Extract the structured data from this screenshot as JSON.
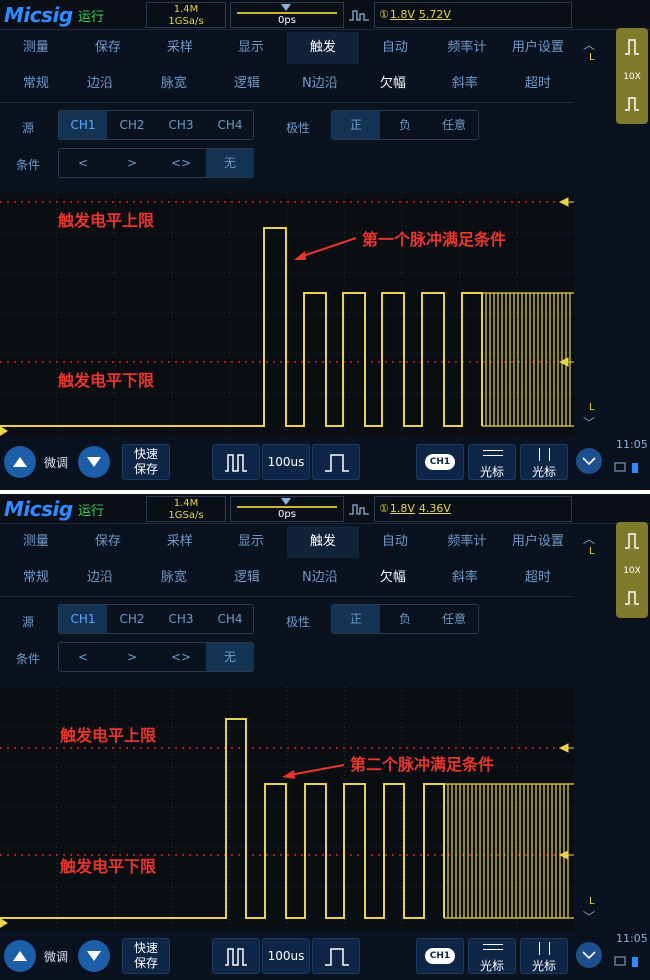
{
  "panels": [
    {
      "header": {
        "logo": "Micsig",
        "run_state": "运行",
        "memory_depth": "1.4M",
        "sample_rate": "1GSa/s",
        "time_offset": "0ps",
        "trigger_channel": "①",
        "trigger_level": "1.8V",
        "trigger_level2": "5.72V"
      },
      "menu": [
        "测量",
        "保存",
        "采样",
        "显示",
        "触发",
        "自动",
        "频率计",
        "用户设置"
      ],
      "submenu": [
        "常规",
        "边沿",
        "脉宽",
        "逻辑",
        "N边沿",
        "欠幅",
        "斜率",
        "超时"
      ],
      "source_label": "源",
      "sources": [
        "CH1",
        "CH2",
        "CH3",
        "CH4"
      ],
      "polarity_label": "极性",
      "polarities": [
        "正",
        "负",
        "任意"
      ],
      "condition_label": "条件",
      "conditions": [
        "<",
        ">",
        "<>",
        "无"
      ],
      "annotations": {
        "upper": "触发电平上限",
        "lower": "触发电平下限",
        "pulse": "第一个脉冲满足条件"
      },
      "right": {
        "marker_top": "L",
        "marker_bottom": "L",
        "probe": "10X"
      },
      "bottom": {
        "fine": "微调",
        "quick_save_1": "快速",
        "quick_save_2": "保存",
        "timebase": "100us",
        "ch_badge": "CH1",
        "cursor_1": "光标",
        "cursor_2": "光标",
        "time": "11:05"
      }
    },
    {
      "header": {
        "logo": "Micsig",
        "run_state": "运行",
        "memory_depth": "1.4M",
        "sample_rate": "1GSa/s",
        "time_offset": "0ps",
        "trigger_channel": "①",
        "trigger_level": "1.8V",
        "trigger_level2": "4.36V"
      },
      "menu": [
        "测量",
        "保存",
        "采样",
        "显示",
        "触发",
        "自动",
        "频率计",
        "用户设置"
      ],
      "submenu": [
        "常规",
        "边沿",
        "脉宽",
        "逻辑",
        "N边沿",
        "欠幅",
        "斜率",
        "超时"
      ],
      "source_label": "源",
      "sources": [
        "CH1",
        "CH2",
        "CH3",
        "CH4"
      ],
      "polarity_label": "极性",
      "polarities": [
        "正",
        "负",
        "任意"
      ],
      "condition_label": "条件",
      "conditions": [
        "<",
        ">",
        "<>",
        "无"
      ],
      "annotations": {
        "upper": "触发电平上限",
        "lower": "触发电平下限",
        "pulse": "第二个脉冲满足条件"
      },
      "right": {
        "marker_top": "L",
        "marker_bottom": "L",
        "probe": "10X"
      },
      "bottom": {
        "fine": "微调",
        "quick_save_1": "快速",
        "quick_save_2": "保存",
        "timebase": "100us",
        "ch_badge": "CH1",
        "cursor_1": "光标",
        "cursor_2": "光标",
        "time": "11:05"
      }
    }
  ],
  "colors": {
    "accent": "#2f8bff",
    "waveform": "#e7d44a",
    "annotation": "#e8362e",
    "trigger_line": "#d42a2a",
    "run": "#42d15a"
  },
  "active": {
    "menu": "触发",
    "submenu": "欠幅",
    "source": "CH1",
    "polarity": "正",
    "condition": "无"
  }
}
